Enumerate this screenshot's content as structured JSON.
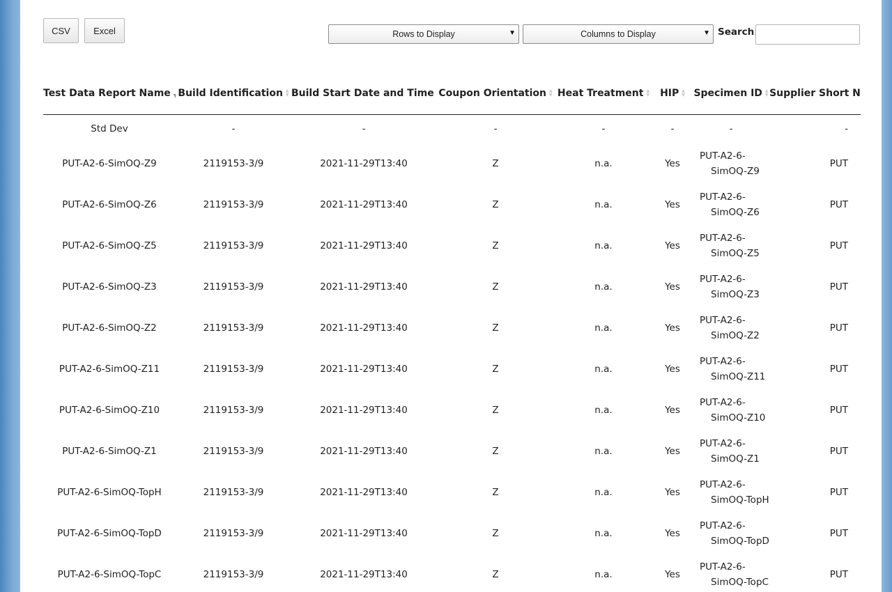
{
  "toolbar": {
    "csv_label": "CSV",
    "excel_label": "Excel",
    "rows_select_label": "Rows to Display",
    "cols_select_label": "Columns to Display",
    "search_label": "Search:",
    "search_value": ""
  },
  "table": {
    "columns": [
      {
        "label": "Test Data Report Name",
        "sort": "desc"
      },
      {
        "label": "Build Identification",
        "sort": "none"
      },
      {
        "label": "Build Start Date and Time",
        "sort": "none"
      },
      {
        "label": "Coupon Orientation",
        "sort": "none"
      },
      {
        "label": "Heat Treatment",
        "sort": "none"
      },
      {
        "label": "HIP",
        "sort": "none"
      },
      {
        "label": "Specimen ID",
        "sort": "none"
      },
      {
        "label": "Supplier Short N",
        "sort": "none"
      }
    ],
    "std_dev_row": [
      "Std Dev",
      "-",
      "-",
      "-",
      "-",
      "-",
      "-",
      "-"
    ],
    "rows": [
      {
        "name": "PUT-A2-6-SimOQ-Z9",
        "build": "2119153-3/9",
        "start": "2021-11-29T13:40",
        "orientation": "Z",
        "heat": "n.a.",
        "hip": "Yes",
        "specimen_1": "PUT-A2-6-",
        "specimen_2": "SimOQ-Z9",
        "supplier": "PUT"
      },
      {
        "name": "PUT-A2-6-SimOQ-Z6",
        "build": "2119153-3/9",
        "start": "2021-11-29T13:40",
        "orientation": "Z",
        "heat": "n.a.",
        "hip": "Yes",
        "specimen_1": "PUT-A2-6-",
        "specimen_2": "SimOQ-Z6",
        "supplier": "PUT"
      },
      {
        "name": "PUT-A2-6-SimOQ-Z5",
        "build": "2119153-3/9",
        "start": "2021-11-29T13:40",
        "orientation": "Z",
        "heat": "n.a.",
        "hip": "Yes",
        "specimen_1": "PUT-A2-6-",
        "specimen_2": "SimOQ-Z5",
        "supplier": "PUT"
      },
      {
        "name": "PUT-A2-6-SimOQ-Z3",
        "build": "2119153-3/9",
        "start": "2021-11-29T13:40",
        "orientation": "Z",
        "heat": "n.a.",
        "hip": "Yes",
        "specimen_1": "PUT-A2-6-",
        "specimen_2": "SimOQ-Z3",
        "supplier": "PUT"
      },
      {
        "name": "PUT-A2-6-SimOQ-Z2",
        "build": "2119153-3/9",
        "start": "2021-11-29T13:40",
        "orientation": "Z",
        "heat": "n.a.",
        "hip": "Yes",
        "specimen_1": "PUT-A2-6-",
        "specimen_2": "SimOQ-Z2",
        "supplier": "PUT"
      },
      {
        "name": "PUT-A2-6-SimOQ-Z11",
        "build": "2119153-3/9",
        "start": "2021-11-29T13:40",
        "orientation": "Z",
        "heat": "n.a.",
        "hip": "Yes",
        "specimen_1": "PUT-A2-6-",
        "specimen_2": "SimOQ-Z11",
        "supplier": "PUT"
      },
      {
        "name": "PUT-A2-6-SimOQ-Z10",
        "build": "2119153-3/9",
        "start": "2021-11-29T13:40",
        "orientation": "Z",
        "heat": "n.a.",
        "hip": "Yes",
        "specimen_1": "PUT-A2-6-",
        "specimen_2": "SimOQ-Z10",
        "supplier": "PUT"
      },
      {
        "name": "PUT-A2-6-SimOQ-Z1",
        "build": "2119153-3/9",
        "start": "2021-11-29T13:40",
        "orientation": "Z",
        "heat": "n.a.",
        "hip": "Yes",
        "specimen_1": "PUT-A2-6-",
        "specimen_2": "SimOQ-Z1",
        "supplier": "PUT"
      },
      {
        "name": "PUT-A2-6-SimOQ-TopH",
        "build": "2119153-3/9",
        "start": "2021-11-29T13:40",
        "orientation": "Z",
        "heat": "n.a.",
        "hip": "Yes",
        "specimen_1": "PUT-A2-6-",
        "specimen_2": "SimOQ-TopH",
        "supplier": "PUT"
      },
      {
        "name": "PUT-A2-6-SimOQ-TopD",
        "build": "2119153-3/9",
        "start": "2021-11-29T13:40",
        "orientation": "Z",
        "heat": "n.a.",
        "hip": "Yes",
        "specimen_1": "PUT-A2-6-",
        "specimen_2": "SimOQ-TopD",
        "supplier": "PUT"
      },
      {
        "name": "PUT-A2-6-SimOQ-TopC",
        "build": "2119153-3/9",
        "start": "2021-11-29T13:40",
        "orientation": "Z",
        "heat": "n.a.",
        "hip": "Yes",
        "specimen_1": "PUT-A2-6-",
        "specimen_2": "SimOQ-TopC",
        "supplier": "PUT"
      }
    ]
  }
}
